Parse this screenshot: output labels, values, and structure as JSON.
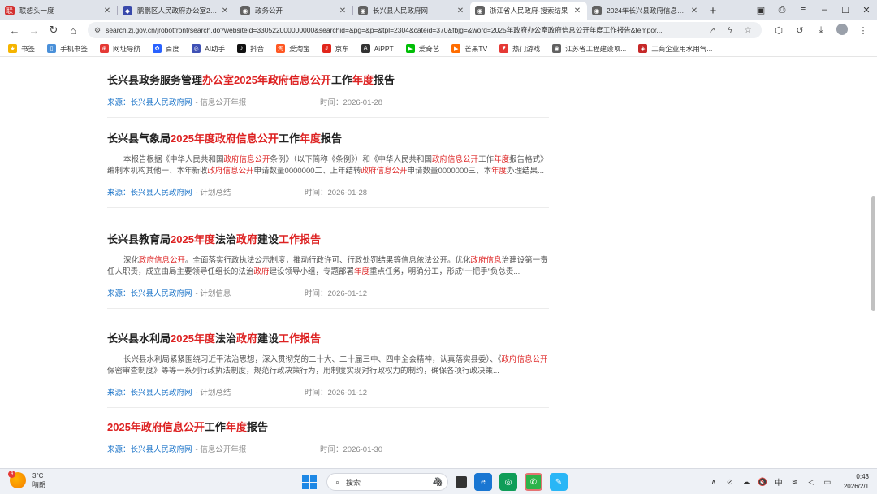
{
  "browser": {
    "tabs": [
      {
        "title": "联想头一度",
        "active": false
      },
      {
        "title": "鹏鹏区人民政府办公室2025年",
        "active": false
      },
      {
        "title": "政务公开",
        "active": false
      },
      {
        "title": "长兴县人民政府网",
        "active": false
      },
      {
        "title": "浙江省人民政府-搜索结果",
        "active": true
      },
      {
        "title": "2024年长兴县政府信息公开",
        "active": false
      }
    ],
    "url": "search.zj.gov.cn/jrobotfront/search.do?websiteid=330522000000000&searchid=&pg=&p=&tpl=2304&cateid=370&fbjg=&word=2025年政府办公室政府信息公开年度工作报告&tempor..."
  },
  "bookmarks": [
    {
      "label": "书签"
    },
    {
      "label": "手机书签"
    },
    {
      "label": "网址导航"
    },
    {
      "label": "百度"
    },
    {
      "label": "AI助手"
    },
    {
      "label": "抖音"
    },
    {
      "label": "爱淘宝"
    },
    {
      "label": "京东"
    },
    {
      "label": "AiPPT"
    },
    {
      "label": "爱奇艺"
    },
    {
      "label": "芒果TV"
    },
    {
      "label": "热门游戏"
    },
    {
      "label": "江苏省工程建设项..."
    },
    {
      "label": "工商企业用水用气..."
    }
  ],
  "results": [
    {
      "title": [
        {
          "t": "长兴县政务服务管理",
          "hl": false
        },
        {
          "t": "办公室2025年政府信息公开",
          "hl": true
        },
        {
          "t": "工作",
          "hl": false
        },
        {
          "t": "年度",
          "hl": true
        },
        {
          "t": "报告",
          "hl": false
        }
      ],
      "desc": [],
      "source_label": "来源：",
      "source": "长兴县人民政府网",
      "category": "- 信息公开年报",
      "time": "时间：2026-01-28"
    },
    {
      "title": [
        {
          "t": "长兴县气象局",
          "hl": false
        },
        {
          "t": "2025年度政府信息公开",
          "hl": true
        },
        {
          "t": "工作",
          "hl": false
        },
        {
          "t": "年度",
          "hl": true
        },
        {
          "t": "报告",
          "hl": false
        }
      ],
      "desc": [
        {
          "t": "本报告根据《中华人民共和国",
          "hl": false
        },
        {
          "t": "政府信息公开",
          "hl": true
        },
        {
          "t": "条例》（以下简称《条例》）和《中华人民共和国",
          "hl": false
        },
        {
          "t": "政府信息公开",
          "hl": true
        },
        {
          "t": "工作",
          "hl": false
        },
        {
          "t": "年度",
          "hl": true
        },
        {
          "t": "报告格式》编制本机构其他一、本年新收",
          "hl": false
        },
        {
          "t": "政府信息公开",
          "hl": true
        },
        {
          "t": "申请数量0000000二、上年结转",
          "hl": false
        },
        {
          "t": "政府信息公开",
          "hl": true
        },
        {
          "t": "申请数量0000000三、本",
          "hl": false
        },
        {
          "t": "年度",
          "hl": true
        },
        {
          "t": "办理结果...",
          "hl": false
        }
      ],
      "source_label": "来源：",
      "source": "长兴县人民政府网",
      "category": "- 计划总结",
      "time": "时间：2026-01-28"
    },
    {
      "title": [
        {
          "t": "长兴县教育局",
          "hl": false
        },
        {
          "t": "2025年度",
          "hl": true
        },
        {
          "t": "法治",
          "hl": false
        },
        {
          "t": "政府",
          "hl": true
        },
        {
          "t": "建设",
          "hl": false
        },
        {
          "t": "工作报告",
          "hl": true
        }
      ],
      "desc": [
        {
          "t": "深化",
          "hl": false
        },
        {
          "t": "政府信息公开",
          "hl": true
        },
        {
          "t": "。全面落实行政执法公示制度，推动行政许可、行政处罚结果等信息依法公开。优化",
          "hl": false
        },
        {
          "t": "政府信息",
          "hl": true
        },
        {
          "t": "治建设第一责任人职责，成立由局主要领导任组长的法治",
          "hl": false
        },
        {
          "t": "政府",
          "hl": true
        },
        {
          "t": "建设领导小组，专题部署",
          "hl": false
        },
        {
          "t": "年度",
          "hl": true
        },
        {
          "t": "重点任务，明确分工，形成“一把手”负总责...",
          "hl": false
        }
      ],
      "source_label": "来源：",
      "source": "长兴县人民政府网",
      "category": "- 计划信息",
      "time": "时间：2026-01-12"
    },
    {
      "title": [
        {
          "t": "长兴县水利局",
          "hl": false
        },
        {
          "t": "2025年度",
          "hl": true
        },
        {
          "t": "法治",
          "hl": false
        },
        {
          "t": "政府",
          "hl": true
        },
        {
          "t": "建设",
          "hl": false
        },
        {
          "t": "工作报告",
          "hl": true
        }
      ],
      "desc": [
        {
          "t": "长兴县水利局紧紧围绕习近平法治思想，深入贯彻党的二十大、二十届三中、四中全会精神，认真落实县委）、《",
          "hl": false
        },
        {
          "t": "政府信息公开",
          "hl": true
        },
        {
          "t": "保密审查制度》等等一系列行政执法制度，规范行政决策行为，用制度实现对行政权力的制约，确保各项行政决策...",
          "hl": false
        }
      ],
      "source_label": "来源：",
      "source": "长兴县人民政府网",
      "category": "- 计划总结",
      "time": "时间：2026-01-12"
    },
    {
      "title": [
        {
          "t": "2025年政府信息公开",
          "hl": true
        },
        {
          "t": "工作",
          "hl": false
        },
        {
          "t": "年度",
          "hl": true
        },
        {
          "t": "报告",
          "hl": false
        }
      ],
      "desc": [],
      "source_label": "来源：",
      "source": "长兴县人民政府网",
      "category": "- 信息公开年报",
      "time": "时间：2026-01-30"
    }
  ],
  "taskbar": {
    "weather_badge": "4",
    "temperature": "3°C",
    "weather": "晴朗",
    "search_placeholder": "搜索",
    "ime": "中",
    "time": "0:43",
    "date": "2026/2/1"
  },
  "colors": {
    "highlight": "#dd2222",
    "link": "#1a73c8",
    "accent": "#1e88e5"
  }
}
